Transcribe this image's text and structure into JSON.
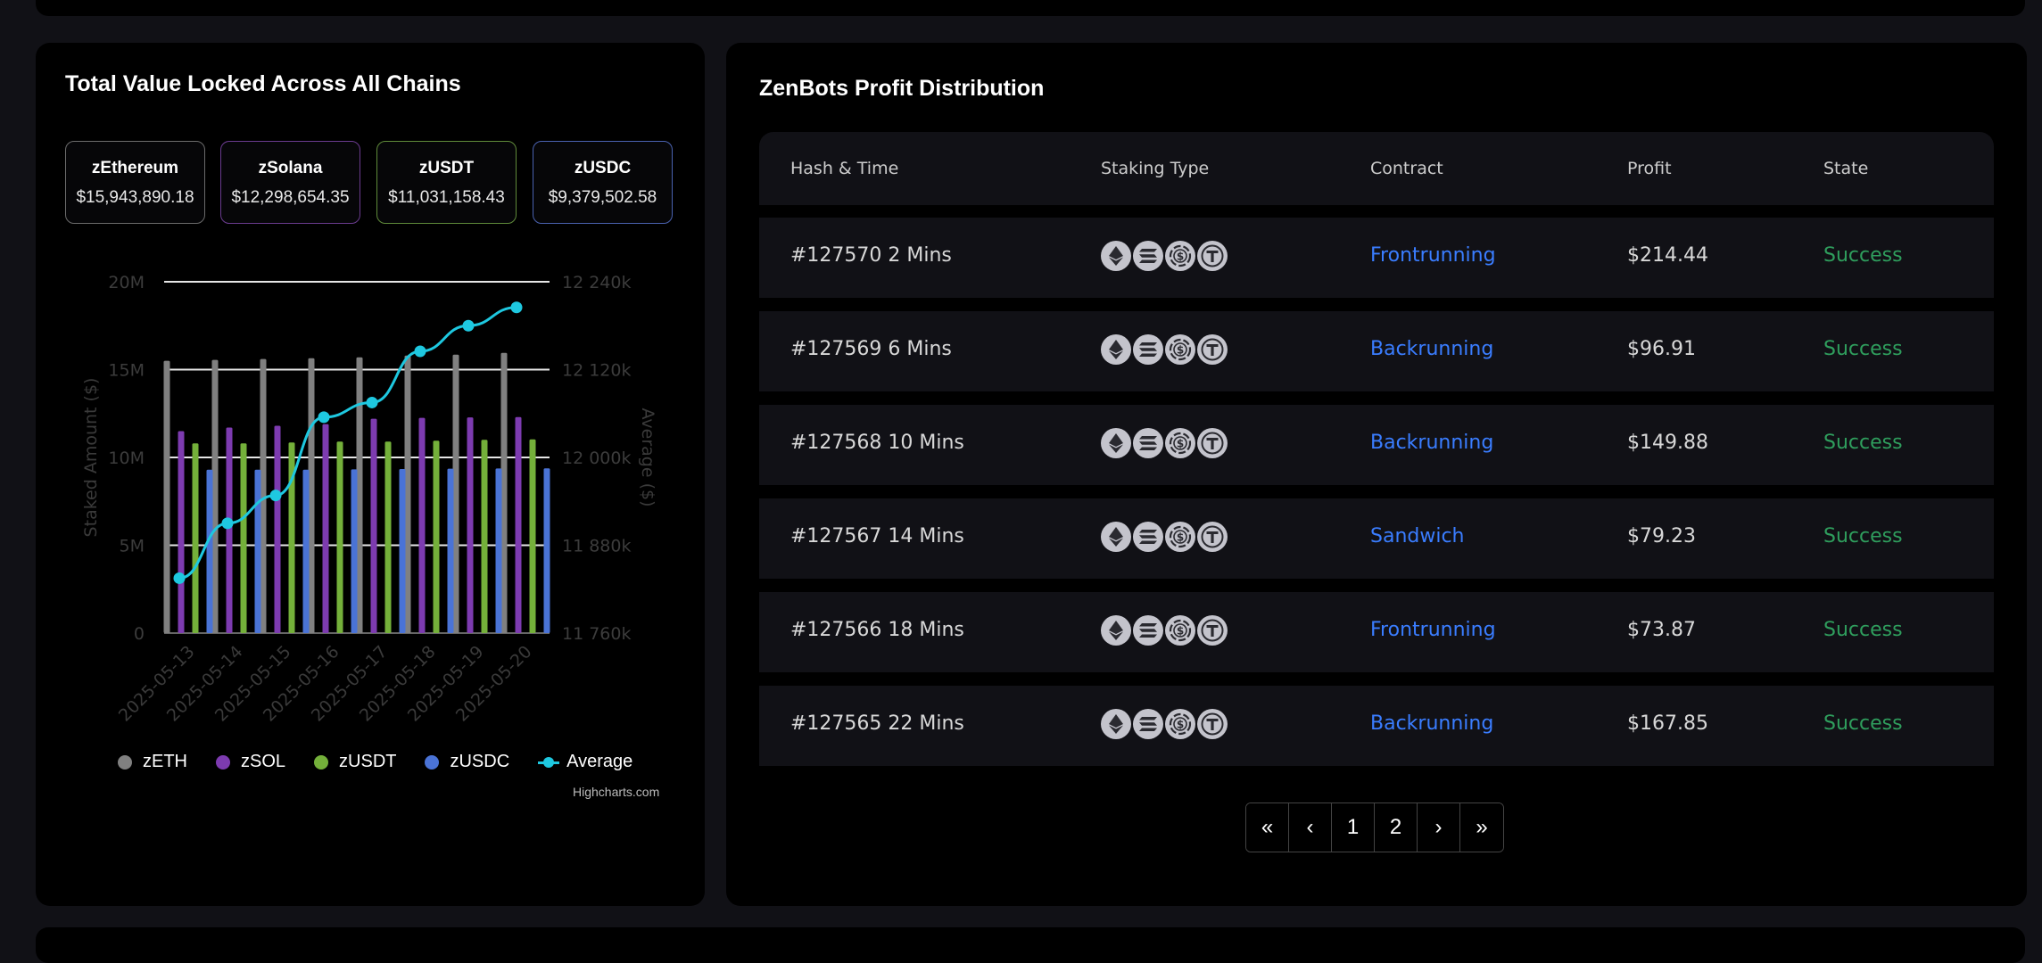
{
  "tvl": {
    "title": "Total Value Locked Across All Chains",
    "cards": [
      {
        "name": "zEthereum",
        "value": "$15,943,890.18",
        "border": "#6b6b6b"
      },
      {
        "name": "zSolana",
        "value": "$12,298,654.35",
        "border": "#6a3b8f"
      },
      {
        "name": "zUSDT",
        "value": "$11,031,158.43",
        "border": "#5f8a3a"
      },
      {
        "name": "zUSDC",
        "value": "$9,379,502.58",
        "border": "#4a62b0"
      }
    ],
    "credit": "Highcharts.com"
  },
  "chart_data": {
    "type": "bar",
    "categories": [
      "2025-05-13",
      "2025-05-14",
      "2025-05-15",
      "2025-05-16",
      "2025-05-17",
      "2025-05-18",
      "2025-05-19",
      "2025-05-20"
    ],
    "ylabel": "Staked Amount ($)",
    "y2label": "Average ($)",
    "ylim": [
      0,
      20000000
    ],
    "y2lim": [
      11760000,
      12240000
    ],
    "yticks": [
      "0",
      "5M",
      "10M",
      "15M",
      "20M"
    ],
    "y2ticks": [
      "11 760k",
      "11 880k",
      "12 000k",
      "12 120k",
      "12 240k"
    ],
    "series": [
      {
        "name": "zETH",
        "color": "#808080",
        "values": [
          15500000,
          15550000,
          15600000,
          15650000,
          15700000,
          15800000,
          15850000,
          15950000
        ]
      },
      {
        "name": "zSOL",
        "color": "#7d3bb0",
        "values": [
          11500000,
          11700000,
          11800000,
          11900000,
          12200000,
          12250000,
          12280000,
          12300000
        ]
      },
      {
        "name": "zUSDT",
        "color": "#74b03a",
        "values": [
          10800000,
          10800000,
          10850000,
          10900000,
          10900000,
          10950000,
          11000000,
          11030000
        ]
      },
      {
        "name": "zUSDC",
        "color": "#4a73d6",
        "values": [
          9300000,
          9300000,
          9300000,
          9320000,
          9340000,
          9360000,
          9370000,
          9380000
        ]
      }
    ],
    "line": {
      "name": "Average",
      "color": "#1ec8e0",
      "values": [
        11835000,
        11910000,
        11948000,
        12055000,
        12075000,
        12145000,
        12180000,
        12205000
      ]
    },
    "legend_position": "bottom"
  },
  "profit": {
    "title": "ZenBots Profit Distribution",
    "columns": [
      "Hash & Time",
      "Staking Type",
      "Contract",
      "Profit",
      "State"
    ],
    "rows": [
      {
        "hash": "#127570 2 Mins",
        "contract": "Frontrunning",
        "profit": "$214.44",
        "state": "Success"
      },
      {
        "hash": "#127569 6 Mins",
        "contract": "Backrunning",
        "profit": "$96.91",
        "state": "Success"
      },
      {
        "hash": "#127568 10 Mins",
        "contract": "Backrunning",
        "profit": "$149.88",
        "state": "Success"
      },
      {
        "hash": "#127567 14 Mins",
        "contract": "Sandwich",
        "profit": "$79.23",
        "state": "Success"
      },
      {
        "hash": "#127566 18 Mins",
        "contract": "Frontrunning",
        "profit": "$73.87",
        "state": "Success"
      },
      {
        "hash": "#127565 22 Mins",
        "contract": "Backrunning",
        "profit": "$167.85",
        "state": "Success"
      }
    ],
    "coin_icons": [
      "ethereum-icon",
      "solana-icon",
      "usdc-icon",
      "tether-icon"
    ],
    "pager": [
      "«",
      "‹",
      "1",
      "2",
      "›",
      "»"
    ]
  },
  "colors": {
    "accent_link": "#3a7dff",
    "success": "#2f9e5d",
    "panel_bg": "#000000",
    "row_bg": "#111116"
  }
}
